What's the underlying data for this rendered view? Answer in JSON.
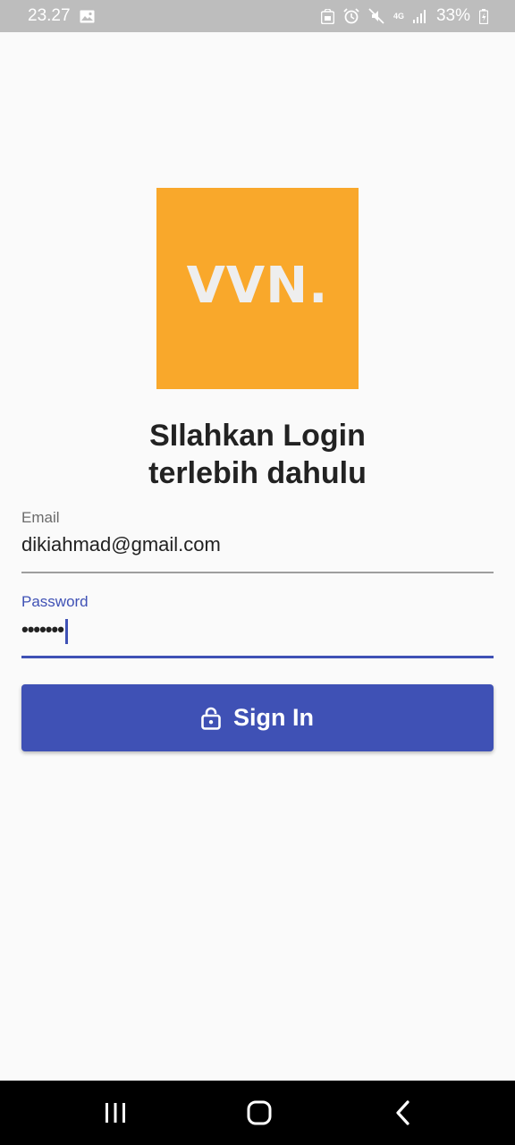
{
  "status_bar": {
    "time": "23.27",
    "network": "4G",
    "battery": "33%",
    "icons": [
      "image-icon",
      "notification-lock-icon",
      "alarm-icon",
      "mute-icon",
      "network-4g-icon",
      "signal-icon",
      "battery-charging-icon"
    ]
  },
  "logo": {
    "text": "VVN.",
    "background": "#f9a82b"
  },
  "heading": {
    "line1": "SIlahkan Login",
    "line2": "terlebih dahulu"
  },
  "email": {
    "label": "Email",
    "value": "dikiahmad@gmail.com"
  },
  "password": {
    "label": "Password",
    "value": "•••••••"
  },
  "sign_in_button": {
    "label": "Sign In",
    "icon": "lock-open-icon"
  },
  "navigation": {
    "icons": [
      "recent-apps-icon",
      "home-icon",
      "back-icon"
    ]
  },
  "colors": {
    "primary": "#3f51b5",
    "accent": "#f9a82b",
    "background": "#fafafa",
    "status_bar": "#bdbdbd"
  }
}
